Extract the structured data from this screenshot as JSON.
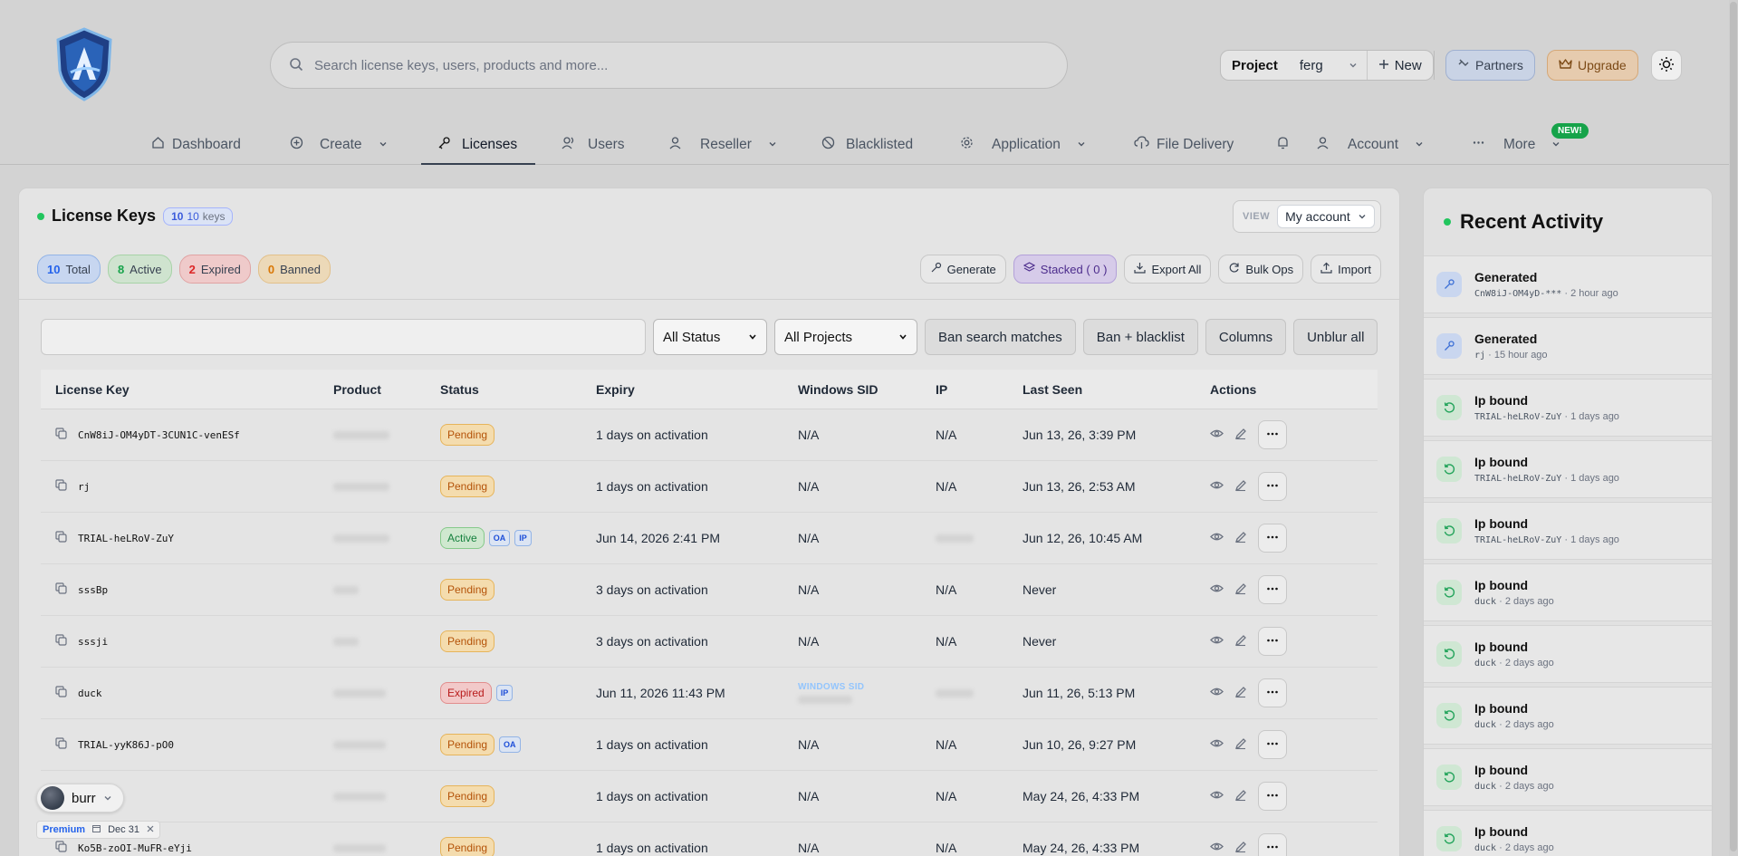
{
  "search": {
    "placeholder": "Search license keys, users, products and more..."
  },
  "header": {
    "project_label": "Project",
    "project_value": "ferg",
    "new_label": "New",
    "partners_label": "Partners",
    "upgrade_label": "Upgrade"
  },
  "nav": {
    "dashboard": "Dashboard",
    "create": "Create",
    "licenses": "Licenses",
    "users": "Users",
    "reseller": "Reseller",
    "blacklisted": "Blacklisted",
    "application": "Application",
    "file_delivery": "File Delivery",
    "account": "Account",
    "more": "More",
    "new_badge": "NEW!"
  },
  "panel": {
    "title": "License Keys",
    "count": "10",
    "count_text": "10",
    "count_unit": "keys",
    "view_label": "VIEW",
    "view_value": "My account",
    "stats": {
      "total_num": "10",
      "total_label": "Total",
      "active_num": "8",
      "active_label": "Active",
      "expired_num": "2",
      "expired_label": "Expired",
      "banned_num": "0",
      "banned_label": "Banned"
    },
    "tools": {
      "generate": "Generate",
      "stacked": "Stacked ( 0 )",
      "export": "Export All",
      "bulk": "Bulk Ops",
      "import": "Import"
    },
    "filters": {
      "search_value": "",
      "status": "All Status",
      "projects": "All Projects",
      "ban_matches": "Ban search matches",
      "ban_blacklist": "Ban + blacklist",
      "columns": "Columns",
      "unblur": "Unblur all"
    }
  },
  "table": {
    "headers": [
      "License Key",
      "Product",
      "Status",
      "Expiry",
      "Windows SID",
      "IP",
      "Last Seen",
      "Actions"
    ],
    "rows": [
      {
        "key": "CnW8iJ-OM4yDT-3CUN1C-venESf",
        "status": "Pending",
        "expiry": "1 days on activation",
        "sid": "N/A",
        "ip": "N/A",
        "last_seen": "Jun 13, 26, 3:39 PM"
      },
      {
        "key": "rj",
        "status": "Pending",
        "expiry": "1 days on activation",
        "sid": "N/A",
        "ip": "N/A",
        "last_seen": "Jun 13, 26, 2:53 AM"
      },
      {
        "key": "TRIAL-heLRoV-ZuY",
        "status": "Active",
        "tag1": "OA",
        "tag2": "IP",
        "expiry": "Jun 14, 2026 2:41 PM",
        "sid": "N/A",
        "ip": "",
        "last_seen": "Jun 12, 26, 10:45 AM"
      },
      {
        "key": "sssBp",
        "status": "Pending",
        "expiry": "3 days on activation",
        "sid": "N/A",
        "ip": "N/A",
        "last_seen": "Never"
      },
      {
        "key": "sssji",
        "status": "Pending",
        "expiry": "3 days on activation",
        "sid": "N/A",
        "ip": "N/A",
        "last_seen": "Never"
      },
      {
        "key": "duck",
        "status": "Expired",
        "tag1": "IP",
        "expiry": "Jun 11, 2026 11:43 PM",
        "sid_label": "WINDOWS SID",
        "ip": "",
        "last_seen": "Jun 11, 26, 5:13 PM"
      },
      {
        "key": "TRIAL-yyK86J-pO0",
        "status": "Pending",
        "tag1": "OA",
        "expiry": "1 days on activation",
        "sid": "N/A",
        "ip": "N/A",
        "last_seen": "Jun 10, 26, 9:27 PM"
      },
      {
        "key": "",
        "status": "Pending",
        "expiry": "1 days on activation",
        "sid": "N/A",
        "ip": "N/A",
        "last_seen": "May 24, 26, 4:33 PM"
      },
      {
        "key": "Ko5B-zoOI-MuFR-eYji",
        "status": "Pending",
        "expiry": "1 days on activation",
        "sid": "N/A",
        "ip": "N/A",
        "last_seen": "May 24, 26, 4:33 PM"
      }
    ]
  },
  "activity": {
    "title": "Recent Activity",
    "items": [
      {
        "type": "gen",
        "title": "Generated",
        "ref": "CnW8iJ-OM4yD-***",
        "time": "2 hour ago"
      },
      {
        "type": "gen",
        "title": "Generated",
        "ref": "rj",
        "time": "15 hour ago"
      },
      {
        "type": "ip",
        "title": "Ip bound",
        "ref": "TRIAL-heLRoV-ZuY",
        "time": "1 days ago"
      },
      {
        "type": "ip",
        "title": "Ip bound",
        "ref": "TRIAL-heLRoV-ZuY",
        "time": "1 days ago"
      },
      {
        "type": "ip",
        "title": "Ip bound",
        "ref": "TRIAL-heLRoV-ZuY",
        "time": "1 days ago"
      },
      {
        "type": "ip",
        "title": "Ip bound",
        "ref": "duck",
        "time": "2 days ago"
      },
      {
        "type": "ip",
        "title": "Ip bound",
        "ref": "duck",
        "time": "2 days ago"
      },
      {
        "type": "ip",
        "title": "Ip bound",
        "ref": "duck",
        "time": "2 days ago"
      },
      {
        "type": "ip",
        "title": "Ip bound",
        "ref": "duck",
        "time": "2 days ago"
      },
      {
        "type": "ip",
        "title": "Ip bound",
        "ref": "duck",
        "time": "2 days ago"
      }
    ]
  },
  "user": {
    "name": "burr",
    "plan": "Premium",
    "date": "Dec 31"
  },
  "colors": {
    "accent": "#2563eb",
    "active": "#16a34a",
    "expired": "#dc2626",
    "pending": "#d97706",
    "upgrade": "#7c4a16"
  }
}
